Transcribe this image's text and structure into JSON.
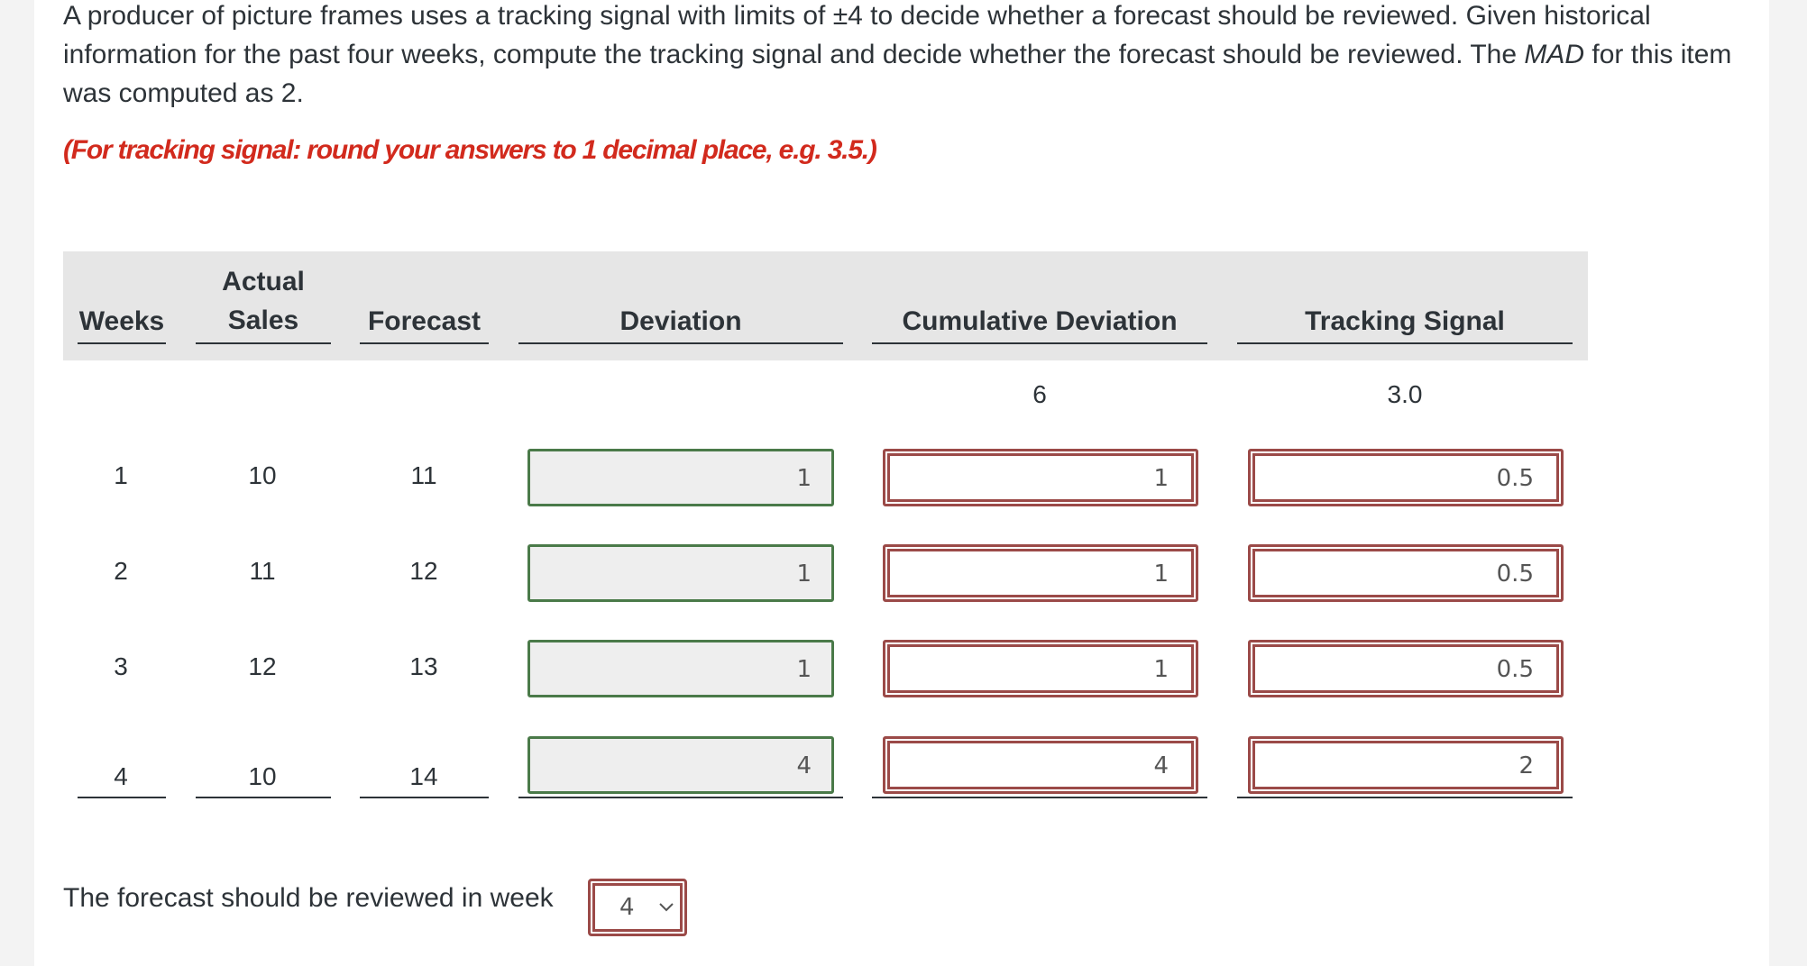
{
  "question": {
    "text_before_mad": "A producer of picture frames uses a tracking signal with limits of ±4 to decide whether a forecast should be reviewed. Given historical information for the past four weeks, compute the tracking signal and decide whether the forecast should be reviewed. The ",
    "mad_term": "MAD",
    "text_after_mad": " for this item was computed as 2.",
    "note": "(For tracking signal: round your answers to 1 decimal place, e.g. 3.5.)"
  },
  "table": {
    "headers": {
      "weeks": "Weeks",
      "actual_1": "Actual",
      "actual_2": "Sales",
      "forecast": "Forecast",
      "deviation": "Deviation",
      "cumulative": "Cumulative Deviation",
      "tracking": "Tracking Signal"
    },
    "initial": {
      "cumulative": "6",
      "tracking": "3.0"
    },
    "rows": [
      {
        "week": "1",
        "actual": "10",
        "forecast": "11",
        "deviation": "1",
        "cumulative": "1",
        "tracking": "0.5"
      },
      {
        "week": "2",
        "actual": "11",
        "forecast": "12",
        "deviation": "1",
        "cumulative": "1",
        "tracking": "0.5"
      },
      {
        "week": "3",
        "actual": "12",
        "forecast": "13",
        "deviation": "1",
        "cumulative": "1",
        "tracking": "0.5"
      },
      {
        "week": "4",
        "actual": "10",
        "forecast": "14",
        "deviation": "4",
        "cumulative": "4",
        "tracking": "2"
      }
    ]
  },
  "review": {
    "label": "The forecast should be reviewed in week",
    "selected": "4"
  },
  "colors": {
    "correct_border": "#4a7a49",
    "incorrect_border": "#9b4a48",
    "note": "#d22a1d",
    "header_bg": "#e6e6e6"
  }
}
